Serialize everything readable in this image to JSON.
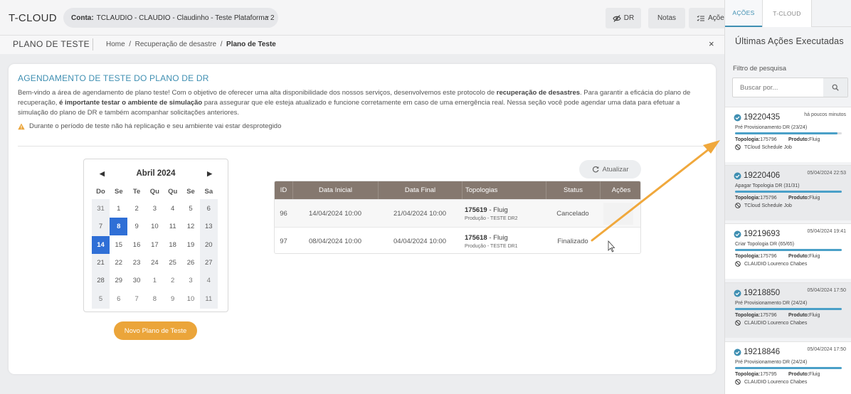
{
  "header": {
    "brand": "T-CLOUD",
    "account_label": "Conta:",
    "account_value": "TCLAUDIO - CLAUDIO - Claudinho - Teste Plataforma 2",
    "dr_label": "DR",
    "notes_label": "Notas",
    "actions_label": "Açõe"
  },
  "breadcrumb": {
    "page_title": "PLANO DE TESTE",
    "home": "Home",
    "divider": "/",
    "level1": "Recuperação de desastre",
    "current": "Plano de Teste",
    "close": "×"
  },
  "card": {
    "title": "AGENDAMENTO DE TESTE DO PLANO DE DR",
    "intro_1": "Bem-vindo a área de agendamento de plano teste! Com o objetivo de oferecer uma alta disponibilidade dos nossos serviços, desenvolvemos este protocolo de ",
    "intro_b1": "recuperação de desastres",
    "intro_2": ". Para garantir a eficácia do plano de recuperação, ",
    "intro_b2": "é importante testar o ambiente de simulação",
    "intro_3": " para assegurar que ele esteja atualizado e funcione corretamente em caso de uma emergência real. Nessa seção você pode agendar uma data para efetuar a simulação do plano de DR e também acompanhar solicitações anteriores.",
    "warning": "Durante o período de teste não há replicação e seu ambiente vai estar desprotegido",
    "new_button": "Novo Plano de Teste",
    "refresh_button": "Atualizar"
  },
  "calendar": {
    "month": "Abril 2024",
    "prev": "◀",
    "next": "▶",
    "weekdays": [
      "Do",
      "Se",
      "Te",
      "Qu",
      "Qu",
      "Se",
      "Sa"
    ],
    "weeks": [
      [
        "31",
        "1",
        "2",
        "3",
        "4",
        "5",
        "6"
      ],
      [
        "7",
        "8",
        "9",
        "10",
        "11",
        "12",
        "13"
      ],
      [
        "14",
        "15",
        "16",
        "17",
        "18",
        "19",
        "20"
      ],
      [
        "21",
        "22",
        "23",
        "24",
        "25",
        "26",
        "27"
      ],
      [
        "28",
        "29",
        "30",
        "1",
        "2",
        "3",
        "4"
      ],
      [
        "5",
        "6",
        "7",
        "8",
        "9",
        "10",
        "11"
      ]
    ],
    "highlighted": [
      "8",
      "14"
    ]
  },
  "table": {
    "columns": [
      "ID",
      "Data Inicial",
      "Data Final",
      "Topologias",
      "Status",
      "Ações"
    ],
    "rows": [
      {
        "id": "96",
        "start": "14/04/2024 10:00",
        "end": "21/04/2024 10:00",
        "topo_id": "175619",
        "topo_name": "- Fluig",
        "topo_env": "Produção - TESTE DR2",
        "status": "Cancelado"
      },
      {
        "id": "97",
        "start": "08/04/2024 10:00",
        "end": "04/04/2024 10:00",
        "topo_id": "175618",
        "topo_name": "- Fluig",
        "topo_env": "Produção - TESTE DR1",
        "status": "Finalizado"
      }
    ]
  },
  "panel": {
    "tab_active": "AÇÕES",
    "tab_other": "T-CLOUD",
    "title": "Últimas Ações Executadas",
    "filter_label": "Filtro de pesquisa",
    "search_placeholder": "Buscar por...",
    "topology_label": "Topologia:",
    "product_label": "Produto:",
    "actions": [
      {
        "id": "19220435",
        "when": "há poucos minutos",
        "desc": "Pré Provisionamento DR (23/24)",
        "progress": 0.96,
        "topology": "175796",
        "product": "Fluig",
        "who": "TCloud Schedule Job"
      },
      {
        "id": "19220406",
        "when": "05/04/2024 22:53",
        "desc": "Apagar Topologia DR (31/31)",
        "progress": 1.0,
        "topology": "175796",
        "product": "Fluig",
        "who": "TCloud Schedule Job"
      },
      {
        "id": "19219693",
        "when": "05/04/2024 19:41",
        "desc": "Criar Topologia DR (65/65)",
        "progress": 1.0,
        "topology": "175796",
        "product": "Fluig",
        "who": "CLAUDIO Lourenco Chabes"
      },
      {
        "id": "19218850",
        "when": "05/04/2024 17:50",
        "desc": "Pré Provisionamento DR (24/24)",
        "progress": 1.0,
        "topology": "175796",
        "product": "Fluig",
        "who": "CLAUDIO Lourenco Chabes"
      },
      {
        "id": "19218846",
        "when": "05/04/2024 17:50",
        "desc": "Pré Provisionamento DR (24/24)",
        "progress": 1.0,
        "topology": "175795",
        "product": "Fluig",
        "who": "CLAUDIO Lourenco Chabes"
      }
    ]
  },
  "colors": {
    "accent": "#3f8fb2",
    "selected_day": "#2f6fd6",
    "new_button": "#eba53a",
    "table_header": "#85786f",
    "progress": "#4aa0c8",
    "arrow": "#f0a83c"
  },
  "icons": [
    "eye-slash-icon",
    "checklist-icon",
    "warning-icon",
    "refresh-icon",
    "search-icon",
    "check-circle-icon",
    "user-slash-icon",
    "chevron-down-icon",
    "cursor-icon"
  ]
}
